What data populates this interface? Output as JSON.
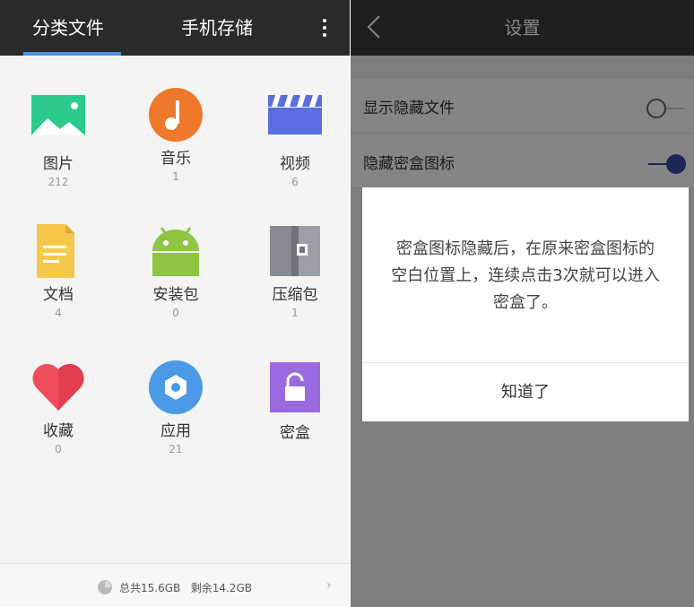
{
  "file_manager": {
    "tabs": [
      {
        "label": "分类文件",
        "active": true
      },
      {
        "label": "手机存储",
        "active": false
      }
    ],
    "menu_icon": "more-vertical-icon",
    "categories": [
      {
        "label": "图片",
        "count": "212",
        "icon": "image-icon",
        "color": "#2ccb8c"
      },
      {
        "label": "音乐",
        "count": "1",
        "icon": "music-icon",
        "color": "#f0782a"
      },
      {
        "label": "视频",
        "count": "6",
        "icon": "video-icon",
        "color": "#5a6ee0"
      },
      {
        "label": "文档",
        "count": "4",
        "icon": "document-icon",
        "color": "#f7c94a"
      },
      {
        "label": "安装包",
        "count": "0",
        "icon": "android-package-icon",
        "color": "#8fc540"
      },
      {
        "label": "压缩包",
        "count": "1",
        "icon": "archive-icon",
        "color": "#9aa0a6"
      },
      {
        "label": "收藏",
        "count": "0",
        "icon": "heart-icon",
        "color": "#ef4c5c"
      },
      {
        "label": "应用",
        "count": "21",
        "icon": "app-icon",
        "color": "#4a9ae6"
      },
      {
        "label": "密盒",
        "count": "",
        "icon": "lock-box-icon",
        "color": "#9a6ae0"
      }
    ],
    "storage": {
      "total": "总共15.6GB",
      "remaining": "剩余14.2GB",
      "icon": "storage-pie-icon"
    }
  },
  "settings": {
    "title": "设置",
    "back_icon": "back-chevron-icon",
    "rows": [
      {
        "label": "显示隐藏文件",
        "toggle_on": false
      },
      {
        "label": "隐藏密盒图标",
        "toggle_on": true
      }
    ],
    "dialog": {
      "message": "密盒图标隐藏后，在原来密盒图标的空白位置上，连续点击3次就可以进入密盒了。",
      "button": "知道了"
    },
    "accent": "#3b47a8"
  }
}
